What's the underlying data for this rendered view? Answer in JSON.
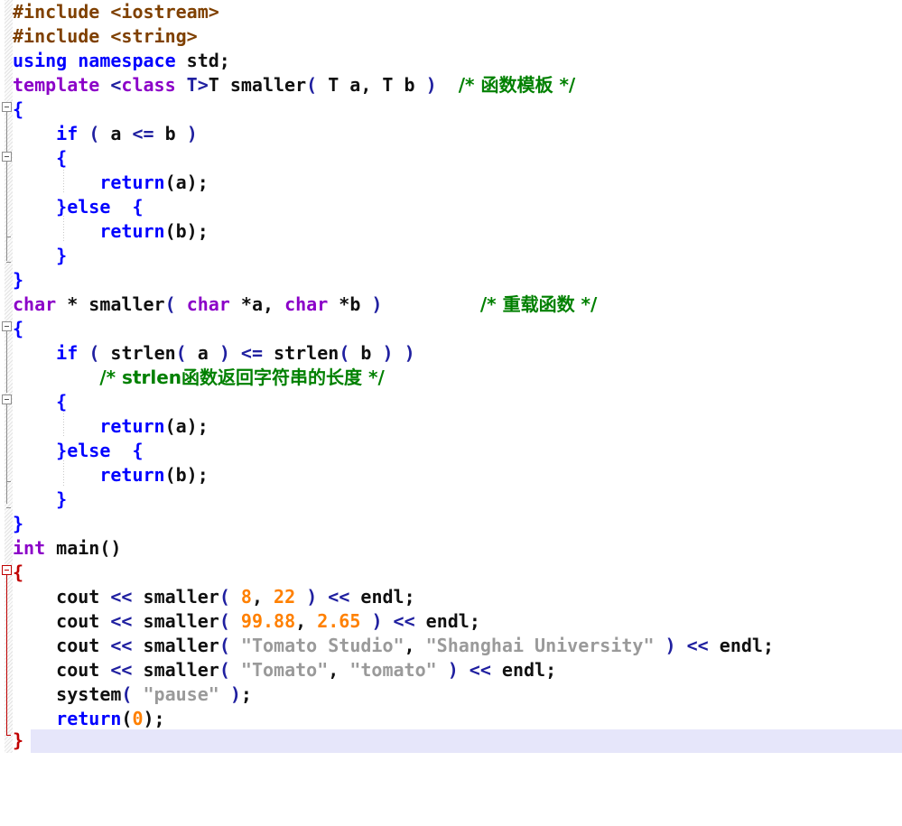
{
  "app": {
    "type": "code-editor",
    "language": "C++",
    "background": "#ffffff",
    "current_line_highlight_color": "#e6e6fa"
  },
  "palette": {
    "preprocessor": "#7f4000",
    "keyword": "#0000ff",
    "type_keyword": "#8b00c8",
    "plain": "#101010",
    "operator": "#2020a0",
    "number": "#ff8000",
    "string": "#9a9a9a",
    "comment": "#008000",
    "brace_blue": "#0000ff",
    "brace_red": "#c00000",
    "gutter_fold": "#8c8c8c"
  },
  "code_lines": [
    {
      "n": 1,
      "indent": 0,
      "text": "#include <iostream>"
    },
    {
      "n": 2,
      "indent": 0,
      "text": "#include <string>"
    },
    {
      "n": 3,
      "indent": 0,
      "text": "using namespace std;"
    },
    {
      "n": 4,
      "indent": 0,
      "text": "template <class T>T smaller( T a, T b )  /* 函数模板 */"
    },
    {
      "n": 5,
      "indent": 0,
      "text": "{"
    },
    {
      "n": 6,
      "indent": 1,
      "text": "if ( a <= b )"
    },
    {
      "n": 7,
      "indent": 1,
      "text": "{"
    },
    {
      "n": 8,
      "indent": 2,
      "text": "return(a);"
    },
    {
      "n": 9,
      "indent": 1,
      "text": "}else  {"
    },
    {
      "n": 10,
      "indent": 2,
      "text": "return(b);"
    },
    {
      "n": 11,
      "indent": 1,
      "text": "}"
    },
    {
      "n": 12,
      "indent": 0,
      "text": "}"
    },
    {
      "n": 13,
      "indent": 0,
      "text": "char * smaller( char *a, char *b )          /* 重载函数 */"
    },
    {
      "n": 14,
      "indent": 0,
      "text": "{"
    },
    {
      "n": 15,
      "indent": 1,
      "text": "if ( strlen( a ) <= strlen( b ) )"
    },
    {
      "n": 16,
      "indent": 2,
      "text": "/* strlen函数返回字符串的长度 */"
    },
    {
      "n": 17,
      "indent": 1,
      "text": "{"
    },
    {
      "n": 18,
      "indent": 2,
      "text": "return(a);"
    },
    {
      "n": 19,
      "indent": 1,
      "text": "}else  {"
    },
    {
      "n": 20,
      "indent": 2,
      "text": "return(b);"
    },
    {
      "n": 21,
      "indent": 1,
      "text": "}"
    },
    {
      "n": 22,
      "indent": 0,
      "text": "}"
    },
    {
      "n": 23,
      "indent": 0,
      "text": "int main()"
    },
    {
      "n": 24,
      "indent": 0,
      "text": "{"
    },
    {
      "n": 25,
      "indent": 1,
      "text": "cout << smaller( 8, 22 ) << endl;"
    },
    {
      "n": 26,
      "indent": 1,
      "text": "cout << smaller( 99.88, 2.65 ) << endl;"
    },
    {
      "n": 27,
      "indent": 1,
      "text": "cout << smaller( \"Tomato Studio\", \"Shanghai University\" ) << endl;"
    },
    {
      "n": 28,
      "indent": 1,
      "text": "cout << smaller( \"Tomato\", \"tomato\" ) << endl;"
    },
    {
      "n": 29,
      "indent": 1,
      "text": "system( \"pause\" );"
    },
    {
      "n": 30,
      "indent": 1,
      "text": "return(0);"
    },
    {
      "n": 31,
      "indent": 0,
      "text": "}"
    }
  ],
  "tokens": {
    "line1": [
      {
        "t": "#include ",
        "c": "t-pre"
      },
      {
        "t": "<iostream>",
        "c": "t-pre"
      }
    ],
    "line2": [
      {
        "t": "#include ",
        "c": "t-pre"
      },
      {
        "t": "<string>",
        "c": "t-pre"
      }
    ],
    "line3": [
      {
        "t": "using namespace ",
        "c": "t-kw"
      },
      {
        "t": "std;",
        "c": "t-plain"
      }
    ],
    "line4": [
      {
        "t": "template ",
        "c": "t-type"
      },
      {
        "t": "<",
        "c": "t-op"
      },
      {
        "t": "class",
        "c": "t-type"
      },
      {
        "t": " T>",
        "c": "t-op"
      },
      {
        "t": "T smaller",
        "c": "t-plain"
      },
      {
        "t": "(",
        "c": "t-op"
      },
      {
        "t": " T a, T b ",
        "c": "t-plain"
      },
      {
        "t": ")",
        "c": "t-op"
      },
      {
        "t": "  ",
        "c": "t-plain"
      },
      {
        "t": "/* 函数模板 */",
        "c": "t-cmt"
      }
    ],
    "line13": [
      {
        "t": "char",
        "c": "t-type"
      },
      {
        "t": " * smaller",
        "c": "t-plain"
      },
      {
        "t": "(",
        "c": "t-op"
      },
      {
        "t": " ",
        "c": "t-plain"
      },
      {
        "t": "char",
        "c": "t-type"
      },
      {
        "t": " *a, ",
        "c": "t-plain"
      },
      {
        "t": "char",
        "c": "t-type"
      },
      {
        "t": " *b ",
        "c": "t-plain"
      },
      {
        "t": ")",
        "c": "t-op"
      },
      {
        "t": "          ",
        "c": "t-plain"
      },
      {
        "t": "/* 重载函数 */",
        "c": "t-cmt"
      }
    ],
    "line16": [
      {
        "t": "/* strlen函数返回字符串的长度 */",
        "c": "t-cmt"
      }
    ],
    "line23": [
      {
        "t": "int",
        "c": "t-type"
      },
      {
        "t": " main()",
        "c": "t-plain"
      }
    ]
  },
  "comments": {
    "function_template": "/* 函数模板 */",
    "overloaded_function": "/* 重载函数 */",
    "strlen_note": "/* strlen函数返回字符串的长度 */"
  },
  "literals": {
    "numbers": [
      "8",
      "22",
      "99.88",
      "2.65",
      "0"
    ],
    "strings": [
      "\"Tomato Studio\"",
      "\"Shanghai University\"",
      "\"Tomato\"",
      "\"tomato\"",
      "\"pause\""
    ]
  },
  "fold_markers": [
    {
      "line": 5,
      "kind": "open",
      "color": "gray"
    },
    {
      "line": 7,
      "kind": "open",
      "color": "gray"
    },
    {
      "line": 14,
      "kind": "open",
      "color": "gray"
    },
    {
      "line": 17,
      "kind": "open",
      "color": "gray"
    },
    {
      "line": 24,
      "kind": "open",
      "color": "red"
    }
  ],
  "current_line": 31
}
